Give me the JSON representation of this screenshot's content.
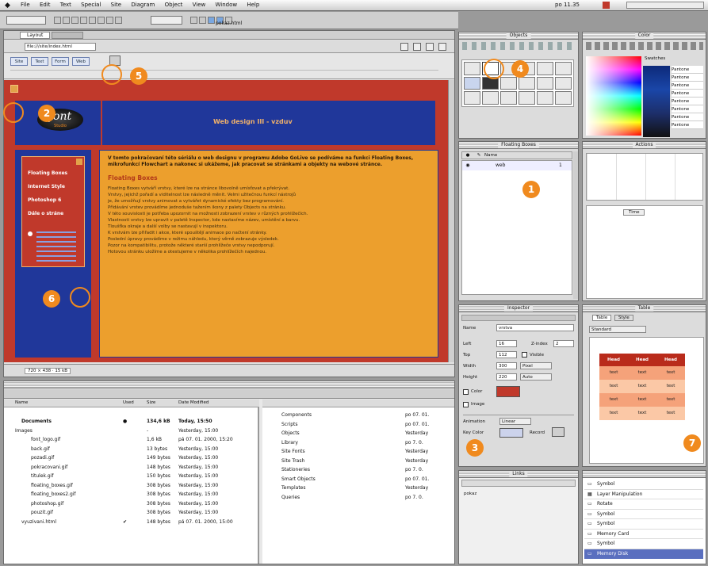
{
  "menubar": {
    "items": [
      "File",
      "Edit",
      "Text",
      "Special",
      "Site",
      "Diagram",
      "Object",
      "View",
      "Window",
      "Help"
    ],
    "clock": "po 11.35"
  },
  "document": {
    "title": "pokaz.html",
    "tab_label": "Layout",
    "url": "file:///site/index.html",
    "toolbar_tabs": [
      "Site",
      "Text",
      "Form",
      "Web"
    ],
    "status": "720 × 438 · 15 kB"
  },
  "webpage": {
    "logo": "font",
    "logo_sub": "Studio",
    "heading": "Web design III - vzduv",
    "nav_links": [
      "Floating Boxes",
      "Internet Style",
      "Photoshop 6",
      "Dále o stráne"
    ],
    "intro": "V tomto pokračovaní této sériálu o web designu v programu Adobe GoLive se podíváme na funkci Floating Boxes, mikrofunkcí Flowchart a nakonec si ukážeme, jak pracovat se stránkami a objekty na webové stránce.",
    "section_title": "Floating Boxes",
    "body_lines": [
      "Floating Boxes vytváří vrstvy, které lze na stránce libovolně umísťovat a překrývat.",
      "Vrstvy, jejichž pořadí a viditelnost lze následně měnit. Velmi užitečnou funkcí nástrojů",
      "je, že umožňují vrstvy animovat a vytvářet dynamické efekty bez programování.",
      "Přidávání vrstev provádíme jednoduše tažením ikony z palety Objects na stránku.",
      "V této souvislosti je potřeba upozornit na možnosti zobrazení vrstev v různých prohlížečích.",
      "Vlastnosti vrstvy lze upravit v paletě Inspector, kde nastavíme název, umístění a barvu.",
      "Tloušťka okraje a další volby se nastavují v inspektoru.",
      "K vrstvám lze přiřadit i akce, které spouštějí animace po načtení stránky.",
      "Poslední úpravy provádíme v režimu náhledu, který věrně zobrazuje výsledek.",
      "Pozor na kompatibilitu, protože některé starší prohlížeče vrstvy nepodporují.",
      "Hotovou stránku uložíme a otestujeme v několika prohlížečích najednou."
    ]
  },
  "objects_palette": {
    "title": "Objects"
  },
  "color_palette": {
    "title": "Color",
    "swatches_label": "Swatches",
    "names": [
      "Pantone",
      "Pantone",
      "Pantone",
      "Pantone",
      "Pantone",
      "Pantone",
      "Pantone",
      "Pantone"
    ]
  },
  "floating_boxes": {
    "title": "Floating Boxes",
    "columns": [
      "",
      "",
      "Name",
      ""
    ],
    "rows": [
      {
        "name": "web"
      }
    ]
  },
  "actions": {
    "title": "Actions",
    "label": "Time"
  },
  "inspector": {
    "title": "Inspector",
    "fields": [
      {
        "label": "Name",
        "value": "vrstva"
      },
      {
        "label": "Left",
        "value": "16",
        "extra_label": "Z-index",
        "extra_value": "2"
      },
      {
        "label": "Top",
        "value": "112",
        "check_label": "Visible"
      },
      {
        "label": "Width",
        "value": "300",
        "unit": "Pixel"
      },
      {
        "label": "Height",
        "value": "220",
        "unit": "Auto"
      }
    ],
    "bgcolor_label": "Color",
    "image_label": "Image",
    "animation_label": "Animation",
    "key_color_label": "Key Color",
    "path_label": "Linear",
    "record_label": "Record"
  },
  "table_palette": {
    "title": "Table",
    "tabs": [
      "Table",
      "Style"
    ],
    "preset": "Standard",
    "headers": [
      "Head",
      "Head",
      "Head"
    ],
    "cells": [
      [
        "text",
        "text",
        "text"
      ],
      [
        "text",
        "text",
        "text"
      ],
      [
        "text",
        "text",
        "text"
      ],
      [
        "text",
        "text",
        "text"
      ]
    ]
  },
  "site_panel": {
    "columns": [
      "Name",
      "Used",
      "Size",
      "Date Modified"
    ],
    "rows": [
      {
        "name": "Documents",
        "used": "",
        "size": "134,6 kB",
        "date": "Today, 15:50"
      },
      {
        "name": "Images",
        "used": "",
        "size": "-",
        "date": "Yesterday, 15:00"
      },
      {
        "name": "font_logo.gif",
        "used": "",
        "size": "1,6 kB",
        "date": "pá 07. 01. 2000, 15:20"
      },
      {
        "name": "back.gif",
        "used": "",
        "size": "13 bytes",
        "date": "Yesterday, 15:00"
      },
      {
        "name": "pozadi.gif",
        "used": "",
        "size": "149 bytes",
        "date": "Yesterday, 15:00"
      },
      {
        "name": "pokracovani.gif",
        "used": "",
        "size": "148 bytes",
        "date": "Yesterday, 15:00"
      },
      {
        "name": "titulek.gif",
        "used": "",
        "size": "150 bytes",
        "date": "Yesterday, 15:00"
      },
      {
        "name": "floating_boxes.gif",
        "used": "",
        "size": "308 bytes",
        "date": "Yesterday, 15:00"
      },
      {
        "name": "floating_boxes2.gif",
        "used": "",
        "size": "308 bytes",
        "date": "Yesterday, 15:00"
      },
      {
        "name": "photoshop.gif",
        "used": "",
        "size": "308 bytes",
        "date": "Yesterday, 15:00"
      },
      {
        "name": "pouzit.gif",
        "used": "",
        "size": "308 bytes",
        "date": "Yesterday, 15:00"
      },
      {
        "name": "vyuzivani.html",
        "used": "",
        "size": "148 bytes",
        "date": "pá 07. 01. 2000, 15:00"
      }
    ]
  },
  "site_panel_right": {
    "rows": [
      {
        "name": "Components",
        "date": "po 07. 01."
      },
      {
        "name": "Scripts",
        "date": "po 07. 01."
      },
      {
        "name": "Objects",
        "date": "Yesterday"
      },
      {
        "name": "Library",
        "date": "po 7. 0."
      },
      {
        "name": "Site Fonts",
        "date": "Yesterday"
      },
      {
        "name": "Site Trash",
        "date": "Yesterday"
      },
      {
        "name": "Stationeries",
        "date": "po 7. 0."
      },
      {
        "name": "Smart Objects",
        "date": "po 07. 01."
      },
      {
        "name": "Templates",
        "date": "Yesterday"
      },
      {
        "name": "Queries",
        "date": "po 7. 0."
      }
    ]
  },
  "links_panel": {
    "title": "Links",
    "label": "pokaz"
  },
  "transform_panel": {
    "rows": [
      "Symbol",
      "Layer Manipulation",
      "Rotate",
      "Symbol",
      "Symbol",
      "Memory Card",
      "Symbol",
      "Memory Disk"
    ]
  },
  "callouts": [
    "1",
    "2",
    "3",
    "4",
    "5",
    "6",
    "7"
  ]
}
